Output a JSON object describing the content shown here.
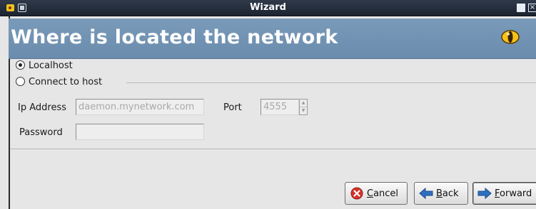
{
  "window": {
    "title": "Wizard"
  },
  "banner": {
    "title": "Where is located the network",
    "logo_icon": "eye-logo-icon"
  },
  "options": {
    "localhost_label": "Localhost",
    "connect_label": "Connect to host",
    "selected": "localhost"
  },
  "host_form": {
    "ip_label": "Ip Address",
    "ip_value": "daemon.mynetwork.com",
    "port_label": "Port",
    "port_value": "4555",
    "password_label": "Password",
    "password_value": ""
  },
  "buttons": {
    "cancel": {
      "mnemonic": "C",
      "rest": "ancel",
      "icon": "cancel-icon"
    },
    "back": {
      "mnemonic": "B",
      "rest": "ack",
      "icon": "back-arrow-icon"
    },
    "forward": {
      "mnemonic": "F",
      "rest": "orward",
      "icon": "forward-arrow-icon"
    }
  },
  "colors": {
    "banner": "#6f8fb0",
    "titlebar": "#232d3a",
    "cancel_icon": "#d8322a",
    "arrow": "#2f6fc0"
  }
}
